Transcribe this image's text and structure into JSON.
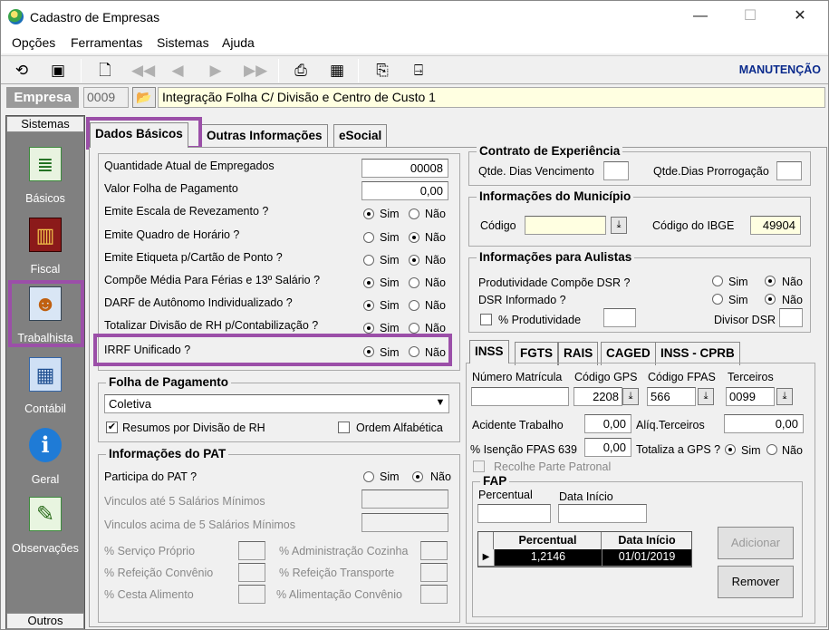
{
  "window": {
    "title": "Cadastro de Empresas",
    "min": "—",
    "max": "☐",
    "close": "✕"
  },
  "menu": {
    "items": [
      "Opções",
      "Ferramentas",
      "Sistemas",
      "Ajuda"
    ]
  },
  "toolbar": {
    "mode_label": "MANUTENÇÃO"
  },
  "empresa": {
    "label": "Empresa",
    "code": "0009",
    "name": "Integração Folha C/ Divisão e Centro de Custo 1"
  },
  "sidebar": {
    "top_header": "Sistemas",
    "bottom_header": "Outros",
    "items": [
      {
        "label": "Básicos",
        "icon": "spreadsheet-icon"
      },
      {
        "label": "Fiscal",
        "icon": "ledger-icon"
      },
      {
        "label": "Trabalhista",
        "icon": "worker-icon"
      },
      {
        "label": "Contábil",
        "icon": "calculator-icon"
      },
      {
        "label": "Geral",
        "icon": "info-computer-icon"
      },
      {
        "label": "Observações",
        "icon": "notes-icon"
      }
    ]
  },
  "tabs": [
    "Dados Básicos",
    "Outras Informações",
    "eSocial"
  ],
  "basic": {
    "qtd_label": "Quantidade Atual de Empregados",
    "qtd_value": "00008",
    "valor_label": "Valor Folha de Pagamento",
    "valor_value": "0,00",
    "sim": "Sim",
    "nao": "Não",
    "questions": [
      "Emite Escala de Revezamento ?",
      "Emite Quadro de Horário ?",
      "Emite Etiqueta p/Cartão de Ponto ?",
      "Compõe Média Para Férias e 13º Salário ?",
      "DARF de Autônomo Individualizado ?",
      "Totalizar Divisão de RH p/Contabilização ?",
      "IRRF Unificado ?"
    ]
  },
  "folha": {
    "title": "Folha de Pagamento",
    "select_value": "Coletiva",
    "resumos_label": "Resumos por Divisão de RH",
    "ordem_label": "Ordem Alfabética"
  },
  "pat": {
    "title": "Informações do PAT",
    "participa_label": "Participa do PAT ?",
    "vinc_ate": "Vinculos até 5 Salários Mínimos",
    "vinc_acima": "Vinculos acima de 5 Salários Mínimos",
    "pct": [
      "% Serviço Próprio",
      "% Administração Cozinha",
      "% Refeição Convênio",
      "% Refeição Transporte",
      "% Cesta Alimento",
      "% Alimentação Convênio"
    ]
  },
  "contrato": {
    "title": "Contrato de Experiência",
    "venc_label": "Qtde. Dias Vencimento",
    "prorr_label": "Qtde.Dias Prorrogação"
  },
  "municipio": {
    "title": "Informações do Município",
    "codigo_label": "Código",
    "ibge_label": "Código do IBGE",
    "ibge_value": "49904"
  },
  "aulistas": {
    "title": "Informações para Aulistas",
    "prod_label": "Produtividade Compõe DSR ?",
    "dsr_label": "DSR Informado ?",
    "pct_prod_label": "% Produtividade",
    "divisor_label": "Divisor DSR"
  },
  "inss_tabs": [
    "INSS",
    "FGTS",
    "RAIS",
    "CAGED",
    "INSS - CPRB"
  ],
  "inss": {
    "matricula_label": "Número Matrícula",
    "gps_label": "Código GPS",
    "gps_value": "2208",
    "fpas_label": "Código FPAS",
    "fpas_value": "566",
    "terceiros_label": "Terceiros",
    "terceiros_value": "0099",
    "acidente_label": "Acidente Trabalho",
    "acidente_value": "0,00",
    "aliq_label": "Alíq.Terceiros",
    "aliq_value": "0,00",
    "isencao_label": "% Isenção FPAS 639",
    "isencao_value": "0,00",
    "totaliza_label": "Totaliza a GPS ?",
    "recolhe_label": "Recolhe Parte Patronal",
    "fap": {
      "title": "FAP",
      "pct_label": "Percentual",
      "data_label": "Data Início",
      "columns": [
        "Percentual",
        "Data Início"
      ],
      "rows": [
        [
          "1,2146",
          "01/01/2019"
        ]
      ]
    },
    "adicionar": "Adicionar",
    "remover": "Remover"
  }
}
